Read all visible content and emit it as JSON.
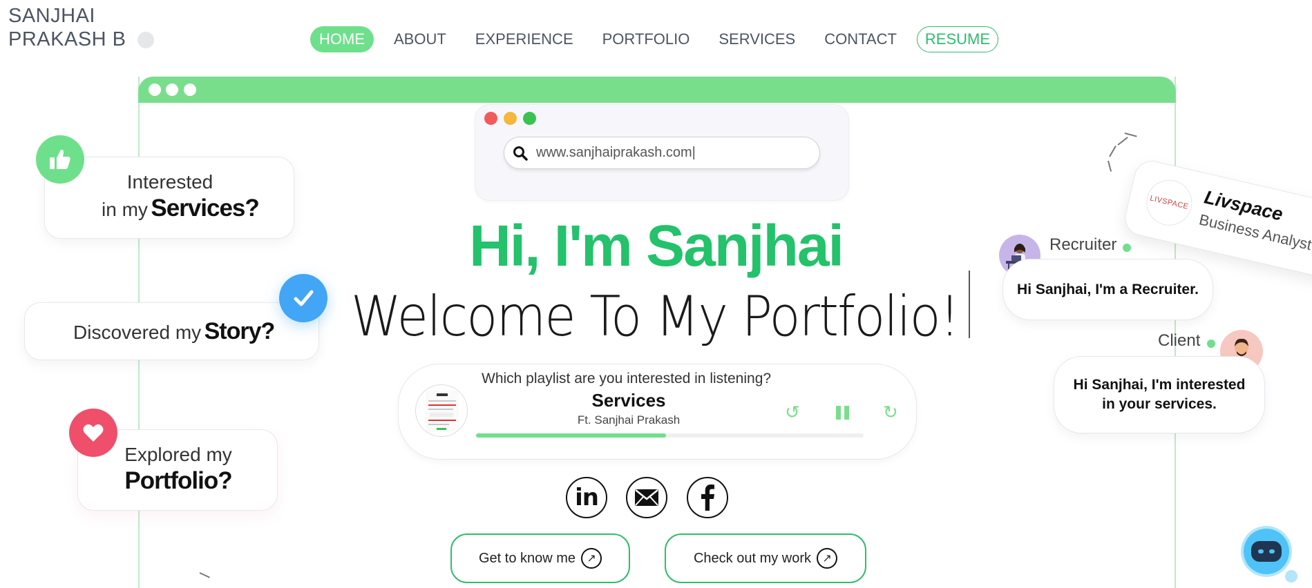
{
  "brand": {
    "line1": "SANJHAI",
    "line2": "PRAKASH B"
  },
  "nav": {
    "items": [
      "HOME",
      "ABOUT",
      "EXPERIENCE",
      "PORTFOLIO",
      "SERVICES",
      "CONTACT"
    ],
    "resume_label": "RESUME",
    "active": "HOME"
  },
  "browser": {
    "url": "www.sanjhaiprakash.com|"
  },
  "hero": {
    "title": "Hi, I'm Sanjhai",
    "subtitle": "Welcome To My Portfolio!"
  },
  "player": {
    "question": "Which playlist are you interested in listening?",
    "title": "Services",
    "artist": "Ft. Sanjhai Prakash",
    "progress_percent": 49
  },
  "social": {
    "linkedin_label": "in",
    "icons": [
      "linkedin-icon",
      "mail-icon",
      "facebook-icon"
    ]
  },
  "cta": {
    "about_label": "Get to know me",
    "work_label": "Check out my work"
  },
  "left_cards": {
    "services": {
      "line1": "Interested",
      "line2_light": "in my",
      "line2_bold": "Services?"
    },
    "story": {
      "light": "Discovered my",
      "bold": "Story?"
    },
    "portfolio": {
      "light": "Explored my",
      "bold": "Portfolio?"
    }
  },
  "right": {
    "recruiter_label": "Recruiter",
    "recruiter_message": "Hi Sanjhai, I'm a Recruiter.",
    "client_label": "Client",
    "client_message_line1": "Hi Sanjhai, I'm interested",
    "client_message_line2": "in your services.",
    "company": {
      "logo_text": "LIVSPACE",
      "name": "Livspace",
      "role": "Business Analyst"
    }
  },
  "colors": {
    "accent": "#23c26b",
    "accent_light": "#79de8c",
    "story_badge": "#42a5f5",
    "heart_badge": "#ef4f6a"
  }
}
